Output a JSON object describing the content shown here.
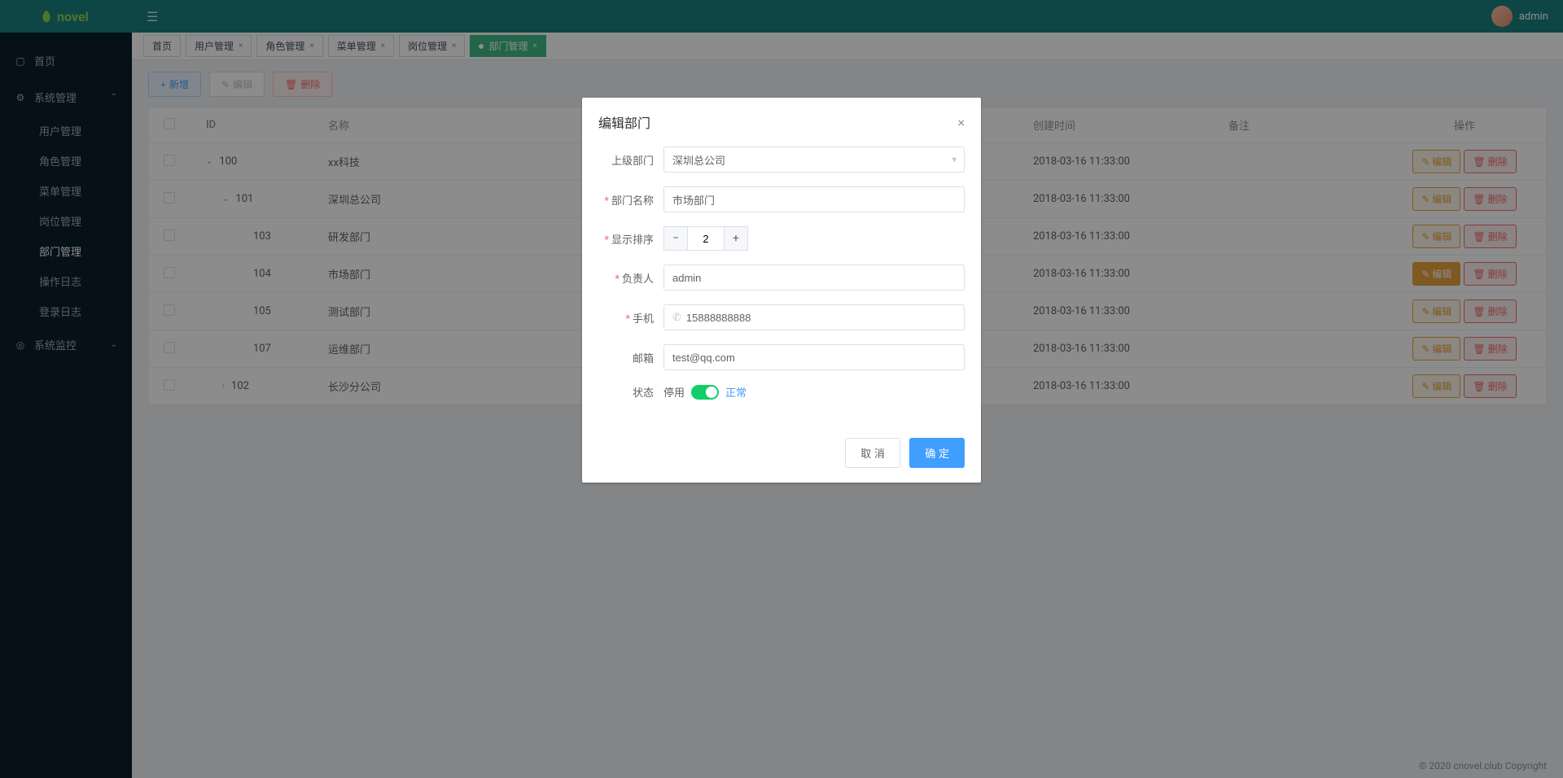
{
  "brand": "novel",
  "user": {
    "name": "admin"
  },
  "sidebar": {
    "home": "首页",
    "group_sys": "系统管理",
    "items": [
      "用户管理",
      "角色管理",
      "菜单管理",
      "岗位管理",
      "部门管理",
      "操作日志",
      "登录日志"
    ],
    "group_monitor": "系统监控"
  },
  "tabs": [
    {
      "label": "首页",
      "closable": false
    },
    {
      "label": "用户管理",
      "closable": true
    },
    {
      "label": "角色管理",
      "closable": true
    },
    {
      "label": "菜单管理",
      "closable": true
    },
    {
      "label": "岗位管理",
      "closable": true
    },
    {
      "label": "部门管理",
      "closable": true,
      "active": true
    }
  ],
  "toolbar": {
    "add": "新增",
    "edit": "编辑",
    "delete": "删除"
  },
  "columns": {
    "id": "ID",
    "name": "名称",
    "time": "创建时间",
    "note": "备注",
    "ops": "操作"
  },
  "rows": [
    {
      "id": "100",
      "name": "xx科技",
      "time": "2018-03-16 11:33:00",
      "expand": "down",
      "indent": 0
    },
    {
      "id": "101",
      "name": "深圳总公司",
      "time": "2018-03-16 11:33:00",
      "expand": "down",
      "indent": 1
    },
    {
      "id": "103",
      "name": "研发部门",
      "time": "2018-03-16 11:33:00",
      "expand": "none",
      "indent": 2
    },
    {
      "id": "104",
      "name": "市场部门",
      "time": "2018-03-16 11:33:00",
      "expand": "none",
      "indent": 2,
      "editActive": true
    },
    {
      "id": "105",
      "name": "测试部门",
      "time": "2018-03-16 11:33:00",
      "expand": "none",
      "indent": 2
    },
    {
      "id": "107",
      "name": "运维部门",
      "time": "2018-03-16 11:33:00",
      "expand": "none",
      "indent": 2
    },
    {
      "id": "102",
      "name": "长沙分公司",
      "time": "2018-03-16 11:33:00",
      "expand": "right",
      "indent": 1
    }
  ],
  "rowOps": {
    "edit": "编辑",
    "delete": "删除"
  },
  "footer": "© 2020 cnovel.club Copyright",
  "dialog": {
    "title": "编辑部门",
    "labels": {
      "parent": "上级部门",
      "name": "部门名称",
      "order": "显示排序",
      "leader": "负责人",
      "phone": "手机",
      "email": "邮箱",
      "status": "状态"
    },
    "values": {
      "parent": "深圳总公司",
      "name": "市场部门",
      "order": "2",
      "leader": "admin",
      "phone": "15888888888",
      "email": "test@qq.com"
    },
    "status_off": "停用",
    "status_on": "正常",
    "cancel": "取 消",
    "confirm": "确 定"
  }
}
